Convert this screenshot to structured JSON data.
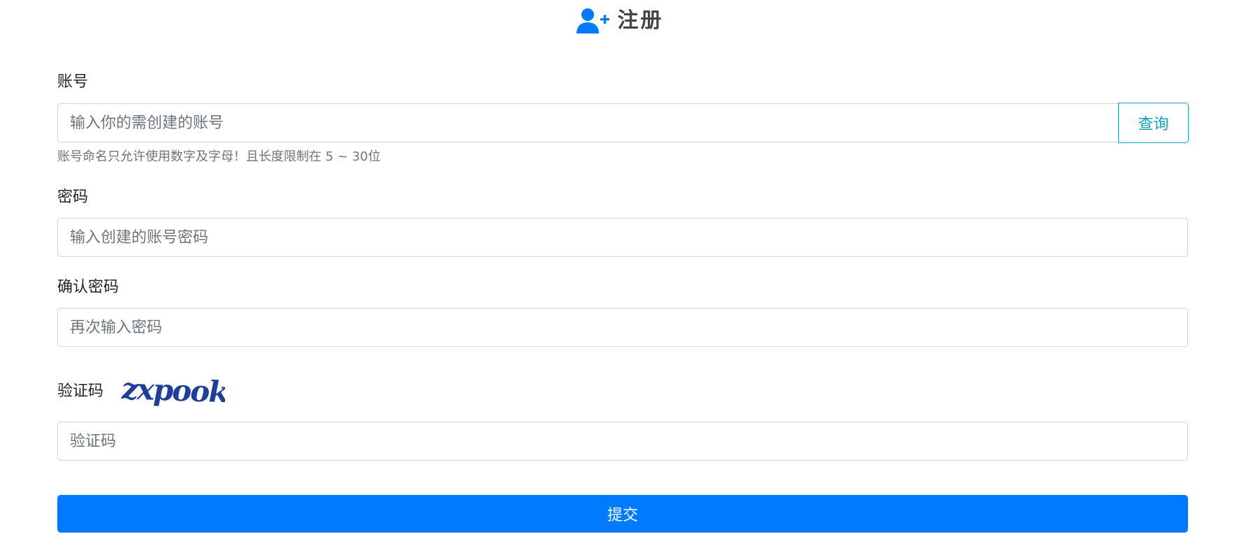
{
  "header": {
    "icon": "user-plus-icon",
    "title": "注册"
  },
  "account": {
    "label": "账号",
    "placeholder": "输入你的需创建的账号",
    "value": "",
    "query_button": "查询",
    "help": "账号命名只允许使用数字及字母！且长度限制在 5 ~ 30位"
  },
  "password": {
    "label": "密码",
    "placeholder": "输入创建的账号密码",
    "value": ""
  },
  "confirm_password": {
    "label": "确认密码",
    "placeholder": "再次输入密码",
    "value": ""
  },
  "captcha": {
    "label": "验证码",
    "image_text": "zxpook",
    "placeholder": "验证码",
    "value": ""
  },
  "submit": {
    "label": "提交"
  },
  "colors": {
    "primary": "#007bff",
    "info": "#17a2b8",
    "captcha_text": "#1f3f9a"
  }
}
